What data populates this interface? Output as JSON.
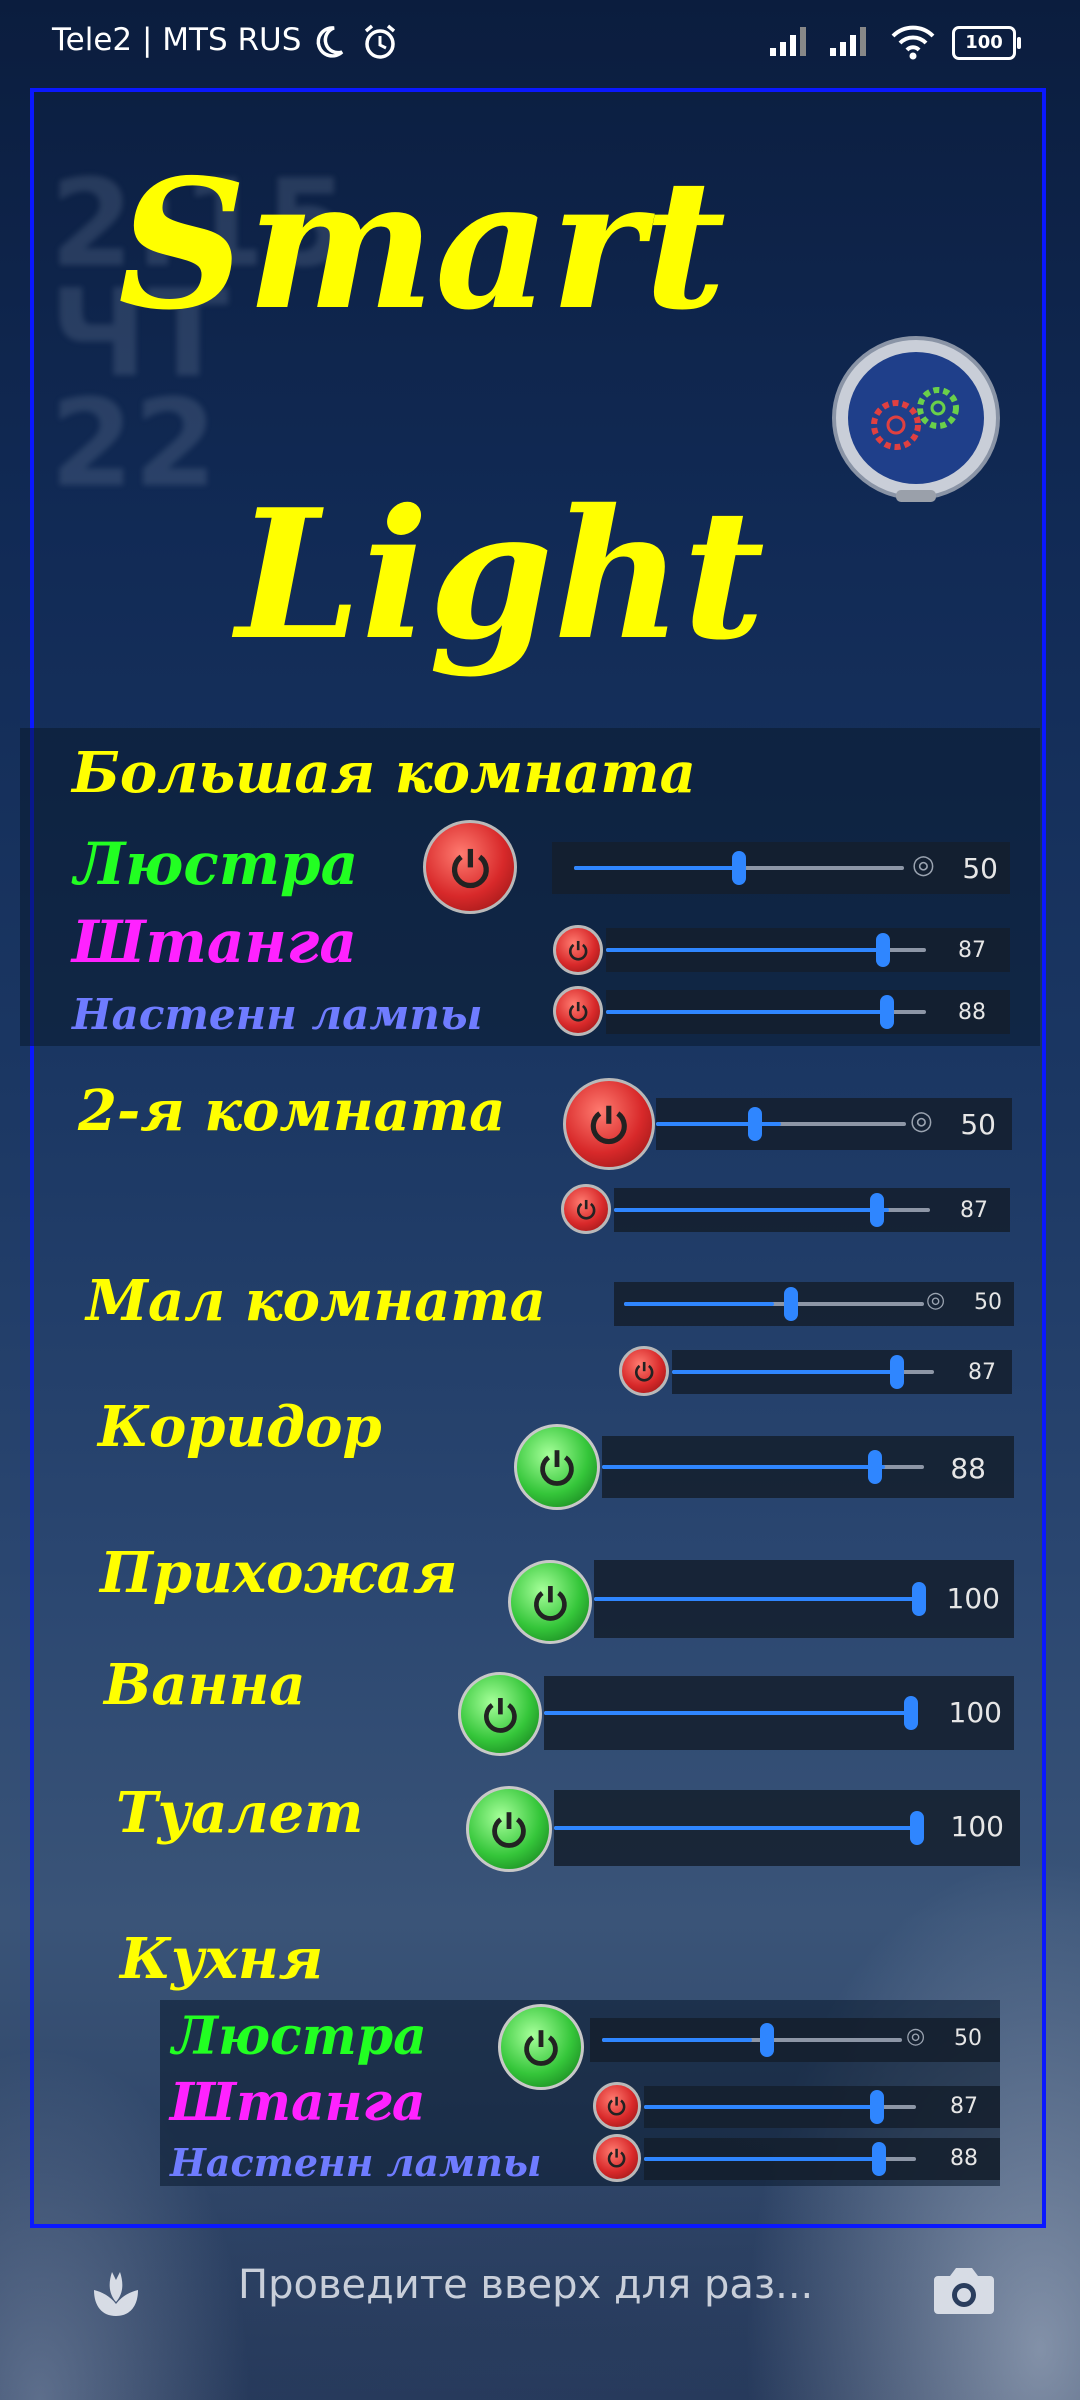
{
  "status_bar": {
    "carrier": "Tele2 | MTS RUS",
    "battery": "100",
    "icons": [
      "moon-icon",
      "alarm-icon",
      "signal-icon",
      "signal-icon",
      "wifi-icon",
      "battery-icon"
    ]
  },
  "header": {
    "title_line1": "Smart",
    "title_line2": "Light",
    "settings_icon": "gears-icon"
  },
  "colors": {
    "yellow": "#ffff00",
    "green": "#22ff22",
    "magenta": "#ff22ff",
    "blue": "#6f7cff",
    "accent": "#2f86ff",
    "frame": "#0a18ff"
  },
  "rooms": {
    "big": {
      "name": "Большая комната",
      "chandelier": {
        "label": "Люстра",
        "power": "off",
        "value": "50"
      },
      "rod": {
        "label": "Штанга",
        "power": "off",
        "value": "87"
      },
      "wall": {
        "label": "Настенн лампы",
        "power": "off",
        "value": "88"
      }
    },
    "second": {
      "name": "2-я комната",
      "main": {
        "power": "off",
        "value": "50"
      },
      "sub": {
        "power": "off",
        "value": "87"
      }
    },
    "small": {
      "name": "Мал комната",
      "main": {
        "value": "50"
      },
      "sub": {
        "power": "off",
        "value": "87"
      }
    },
    "corridor": {
      "name": "Коридор",
      "power": "on",
      "value": "88"
    },
    "hall": {
      "name": "Прихожая",
      "power": "on",
      "value": "100"
    },
    "bath": {
      "name": "Ванна",
      "power": "on",
      "value": "100"
    },
    "toilet": {
      "name": "Туалет",
      "power": "on",
      "value": "100"
    },
    "kitchen": {
      "name": "Кухня",
      "chandelier": {
        "label": "Люстра",
        "power": "on",
        "value": "50"
      },
      "rod": {
        "label": "Штанга",
        "power": "off",
        "value": "87"
      },
      "wall": {
        "label": "Настенн лампы",
        "power": "off",
        "value": "88"
      }
    }
  },
  "lockscreen": {
    "hint": "Проведите вверх для раз...",
    "left_icon": "tulip-icon",
    "right_icon": "camera-icon"
  }
}
